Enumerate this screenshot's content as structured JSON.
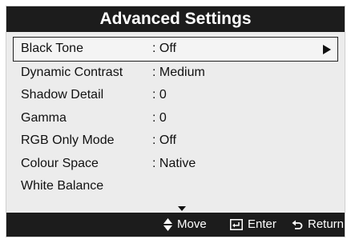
{
  "header": {
    "title": "Advanced Settings"
  },
  "menu": {
    "items": [
      {
        "label": "Black Tone",
        "value": ": Off"
      },
      {
        "label": "Dynamic Contrast",
        "value": ": Medium"
      },
      {
        "label": "Shadow Detail",
        "value": ": 0"
      },
      {
        "label": "Gamma",
        "value": ": 0"
      },
      {
        "label": "RGB Only Mode",
        "value": ": Off"
      },
      {
        "label": "Colour Space",
        "value": ": Native"
      },
      {
        "label": "White Balance",
        "value": ""
      }
    ],
    "selected_index": 0,
    "more_indicator_icon": "down-triangle-icon"
  },
  "footer": {
    "move_label": "Move",
    "enter_label": "Enter",
    "return_label": "Return",
    "icons": [
      "up-down-arrows-icon",
      "enter-key-icon",
      "return-arrow-icon"
    ]
  }
}
